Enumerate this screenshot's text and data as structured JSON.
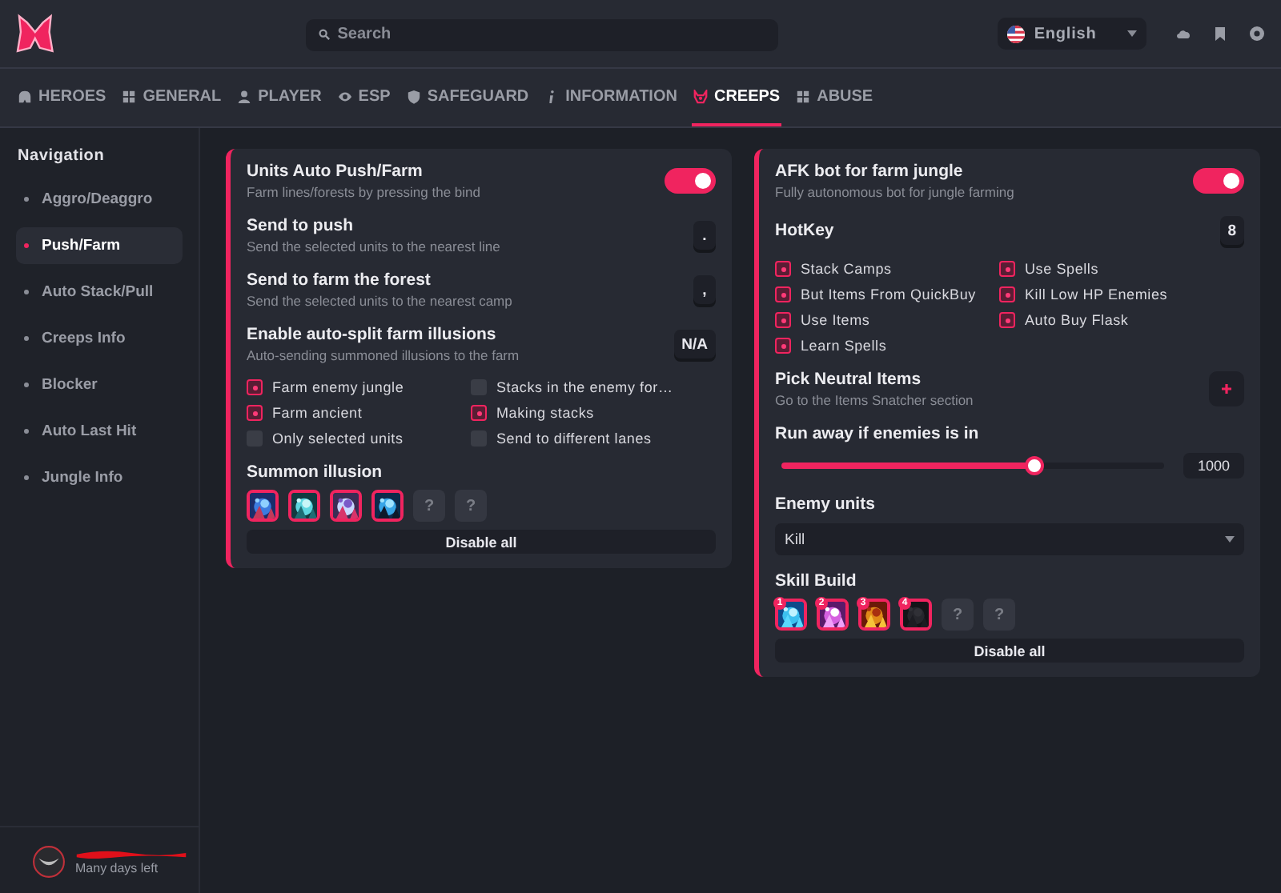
{
  "header": {
    "search": {
      "placeholder": "Search"
    },
    "language": "English"
  },
  "tabs": [
    {
      "label": "HEROES",
      "selected": false
    },
    {
      "label": "GENERAL",
      "selected": false
    },
    {
      "label": "PLAYER",
      "selected": false
    },
    {
      "label": "ESP",
      "selected": false
    },
    {
      "label": "SAFEGUARD",
      "selected": false
    },
    {
      "label": "INFORMATION",
      "selected": false
    },
    {
      "label": "CREEPS",
      "selected": true
    },
    {
      "label": "ABUSE",
      "selected": false
    }
  ],
  "sidebar": {
    "title": "Navigation",
    "items": [
      {
        "label": "Aggro/Deaggro",
        "selected": false
      },
      {
        "label": "Push/Farm",
        "selected": true
      },
      {
        "label": "Auto Stack/Pull",
        "selected": false
      },
      {
        "label": "Creeps Info",
        "selected": false
      },
      {
        "label": "Blocker",
        "selected": false
      },
      {
        "label": "Auto Last Hit",
        "selected": false
      },
      {
        "label": "Jungle Info",
        "selected": false
      }
    ],
    "user": {
      "status": "Many days left"
    }
  },
  "panels": [
    {
      "rows": [
        {
          "kind": "toggle",
          "title": "Units Auto Push/Farm",
          "description": "Farm lines/forests by pressing the bind",
          "on": true
        },
        {
          "kind": "key",
          "title": "Send to push",
          "description": "Send the selected units to the nearest line",
          "key": "."
        },
        {
          "kind": "key",
          "title": "Send to farm the forest",
          "description": "Send the selected units to the nearest camp",
          "key": ","
        },
        {
          "kind": "key",
          "title": "Enable auto-split farm illusions",
          "description": "Auto-sending summoned illusions to the farm",
          "key": "N/A"
        },
        {
          "kind": "checks",
          "items": [
            {
              "label": "Farm enemy jungle",
              "checked": true
            },
            {
              "label": "Stacks in the enemy for…",
              "checked": false
            },
            {
              "label": "Farm ancient",
              "checked": true
            },
            {
              "label": "Making stacks",
              "checked": true
            },
            {
              "label": "Only selected units",
              "checked": false
            },
            {
              "label": "Send to different lanes",
              "checked": false
            }
          ]
        },
        {
          "kind": "slots",
          "title": "Summon illusion",
          "slots": [
            {
              "kind": "picture"
            },
            {
              "kind": "picture"
            },
            {
              "kind": "picture"
            },
            {
              "kind": "picture"
            },
            {
              "kind": "empty",
              "label": "?"
            },
            {
              "kind": "empty",
              "label": "?"
            }
          ],
          "button": "Disable all"
        }
      ]
    },
    {
      "rows": [
        {
          "kind": "toggle",
          "title": "AFK bot for farm jungle",
          "description": "Fully autonomous bot for jungle farming",
          "on": true
        },
        {
          "kind": "key",
          "title": "HotKey",
          "key": "8"
        },
        {
          "kind": "checks",
          "items": [
            {
              "label": "Stack Camps",
              "checked": true
            },
            {
              "label": "Use Spells",
              "checked": true
            },
            {
              "label": "But Items From QuickBuy",
              "checked": true
            },
            {
              "label": "Kill Low HP Enemies",
              "checked": true
            },
            {
              "label": "Use Items",
              "checked": true
            },
            {
              "label": "Auto Buy Flask",
              "checked": true
            },
            {
              "label": "Learn Spells",
              "checked": true
            }
          ]
        },
        {
          "kind": "link",
          "title": "Pick Neutral Items",
          "description": "Go to the Items Snatcher section"
        },
        {
          "kind": "slider",
          "title": "Run away if enemies is in",
          "level": 0.66,
          "reading": "1000"
        },
        {
          "kind": "select",
          "title": "Enemy units",
          "value": "Kill"
        },
        {
          "kind": "slots",
          "title": "Skill Build",
          "slots": [
            {
              "kind": "picture",
              "badge": "1"
            },
            {
              "kind": "picture",
              "badge": "2"
            },
            {
              "kind": "picture",
              "badge": "3"
            },
            {
              "kind": "picture",
              "badge": "4"
            },
            {
              "kind": "empty",
              "label": "?"
            },
            {
              "kind": "empty",
              "label": "?"
            }
          ],
          "button": "Disable all"
        }
      ]
    }
  ]
}
